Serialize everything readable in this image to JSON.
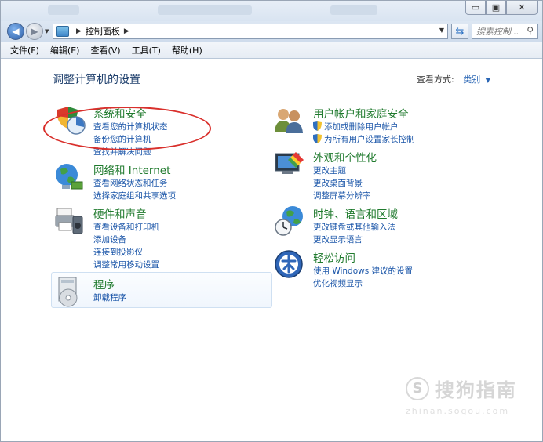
{
  "window": {
    "buttons": {
      "minimize": "▭",
      "maximize": "▣",
      "close": "✕"
    }
  },
  "address": {
    "breadcrumb": "控制面板",
    "search_placeholder": "搜索控制..."
  },
  "menu": [
    "文件(F)",
    "编辑(E)",
    "查看(V)",
    "工具(T)",
    "帮助(H)"
  ],
  "page": {
    "heading": "调整计算机的设置",
    "view_by_label": "查看方式:",
    "view_by_value": "类别"
  },
  "categories": [
    {
      "title": "系统和安全",
      "icon": "shield-chart-icon",
      "links": [
        "查看您的计算机状态",
        "备份您的计算机",
        "查找并解决问题"
      ]
    },
    {
      "title": "网络和 Internet",
      "icon": "globe-network-icon",
      "links": [
        "查看网络状态和任务",
        "选择家庭组和共享选项"
      ]
    },
    {
      "title": "硬件和声音",
      "icon": "printer-speaker-icon",
      "links": [
        "查看设备和打印机",
        "添加设备",
        "连接到投影仪",
        "调整常用移动设置"
      ]
    },
    {
      "title": "程序",
      "icon": "programs-disk-icon",
      "links": [
        "卸载程序"
      ]
    },
    {
      "title": "用户帐户和家庭安全",
      "icon": "users-icon",
      "links": [
        "添加或删除用户帐户",
        "为所有用户设置家长控制"
      ]
    },
    {
      "title": "外观和个性化",
      "icon": "monitor-paint-icon",
      "links": [
        "更改主题",
        "更改桌面背景",
        "调整屏幕分辨率"
      ]
    },
    {
      "title": "时钟、语言和区域",
      "icon": "clock-globe-icon",
      "links": [
        "更改键盘或其他输入法",
        "更改显示语言"
      ]
    },
    {
      "title": "轻松访问",
      "icon": "accessibility-icon",
      "links": [
        "使用 Windows 建议的设置",
        "优化视频显示"
      ]
    }
  ],
  "watermark": {
    "logo": "S",
    "text": "搜狗指南",
    "url": "zhinan.sogou.com"
  }
}
